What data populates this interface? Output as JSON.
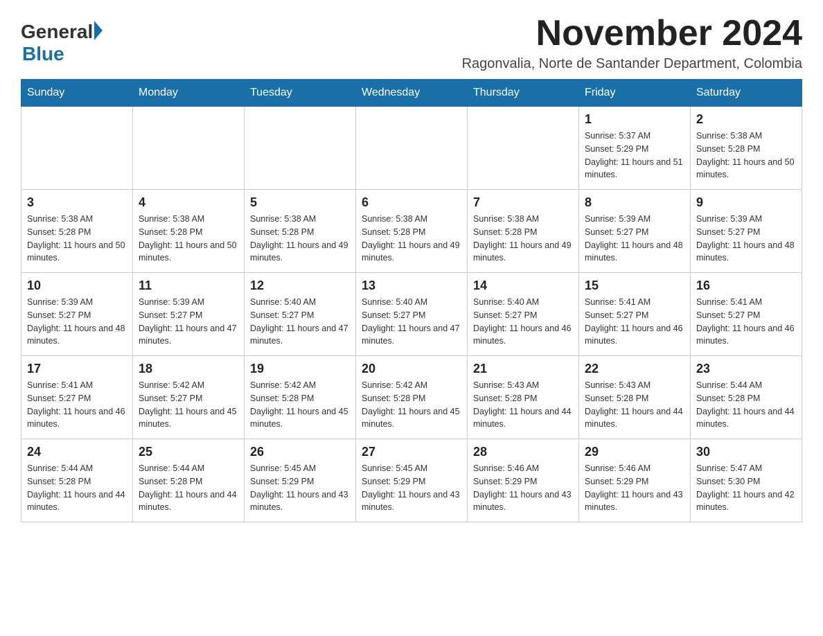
{
  "logo": {
    "general": "General",
    "blue": "Blue"
  },
  "title": "November 2024",
  "location": "Ragonvalia, Norte de Santander Department, Colombia",
  "days_of_week": [
    "Sunday",
    "Monday",
    "Tuesday",
    "Wednesday",
    "Thursday",
    "Friday",
    "Saturday"
  ],
  "weeks": [
    [
      {
        "day": "",
        "info": ""
      },
      {
        "day": "",
        "info": ""
      },
      {
        "day": "",
        "info": ""
      },
      {
        "day": "",
        "info": ""
      },
      {
        "day": "",
        "info": ""
      },
      {
        "day": "1",
        "info": "Sunrise: 5:37 AM\nSunset: 5:29 PM\nDaylight: 11 hours and 51 minutes."
      },
      {
        "day": "2",
        "info": "Sunrise: 5:38 AM\nSunset: 5:28 PM\nDaylight: 11 hours and 50 minutes."
      }
    ],
    [
      {
        "day": "3",
        "info": "Sunrise: 5:38 AM\nSunset: 5:28 PM\nDaylight: 11 hours and 50 minutes."
      },
      {
        "day": "4",
        "info": "Sunrise: 5:38 AM\nSunset: 5:28 PM\nDaylight: 11 hours and 50 minutes."
      },
      {
        "day": "5",
        "info": "Sunrise: 5:38 AM\nSunset: 5:28 PM\nDaylight: 11 hours and 49 minutes."
      },
      {
        "day": "6",
        "info": "Sunrise: 5:38 AM\nSunset: 5:28 PM\nDaylight: 11 hours and 49 minutes."
      },
      {
        "day": "7",
        "info": "Sunrise: 5:38 AM\nSunset: 5:28 PM\nDaylight: 11 hours and 49 minutes."
      },
      {
        "day": "8",
        "info": "Sunrise: 5:39 AM\nSunset: 5:27 PM\nDaylight: 11 hours and 48 minutes."
      },
      {
        "day": "9",
        "info": "Sunrise: 5:39 AM\nSunset: 5:27 PM\nDaylight: 11 hours and 48 minutes."
      }
    ],
    [
      {
        "day": "10",
        "info": "Sunrise: 5:39 AM\nSunset: 5:27 PM\nDaylight: 11 hours and 48 minutes."
      },
      {
        "day": "11",
        "info": "Sunrise: 5:39 AM\nSunset: 5:27 PM\nDaylight: 11 hours and 47 minutes."
      },
      {
        "day": "12",
        "info": "Sunrise: 5:40 AM\nSunset: 5:27 PM\nDaylight: 11 hours and 47 minutes."
      },
      {
        "day": "13",
        "info": "Sunrise: 5:40 AM\nSunset: 5:27 PM\nDaylight: 11 hours and 47 minutes."
      },
      {
        "day": "14",
        "info": "Sunrise: 5:40 AM\nSunset: 5:27 PM\nDaylight: 11 hours and 46 minutes."
      },
      {
        "day": "15",
        "info": "Sunrise: 5:41 AM\nSunset: 5:27 PM\nDaylight: 11 hours and 46 minutes."
      },
      {
        "day": "16",
        "info": "Sunrise: 5:41 AM\nSunset: 5:27 PM\nDaylight: 11 hours and 46 minutes."
      }
    ],
    [
      {
        "day": "17",
        "info": "Sunrise: 5:41 AM\nSunset: 5:27 PM\nDaylight: 11 hours and 46 minutes."
      },
      {
        "day": "18",
        "info": "Sunrise: 5:42 AM\nSunset: 5:27 PM\nDaylight: 11 hours and 45 minutes."
      },
      {
        "day": "19",
        "info": "Sunrise: 5:42 AM\nSunset: 5:28 PM\nDaylight: 11 hours and 45 minutes."
      },
      {
        "day": "20",
        "info": "Sunrise: 5:42 AM\nSunset: 5:28 PM\nDaylight: 11 hours and 45 minutes."
      },
      {
        "day": "21",
        "info": "Sunrise: 5:43 AM\nSunset: 5:28 PM\nDaylight: 11 hours and 44 minutes."
      },
      {
        "day": "22",
        "info": "Sunrise: 5:43 AM\nSunset: 5:28 PM\nDaylight: 11 hours and 44 minutes."
      },
      {
        "day": "23",
        "info": "Sunrise: 5:44 AM\nSunset: 5:28 PM\nDaylight: 11 hours and 44 minutes."
      }
    ],
    [
      {
        "day": "24",
        "info": "Sunrise: 5:44 AM\nSunset: 5:28 PM\nDaylight: 11 hours and 44 minutes."
      },
      {
        "day": "25",
        "info": "Sunrise: 5:44 AM\nSunset: 5:28 PM\nDaylight: 11 hours and 44 minutes."
      },
      {
        "day": "26",
        "info": "Sunrise: 5:45 AM\nSunset: 5:29 PM\nDaylight: 11 hours and 43 minutes."
      },
      {
        "day": "27",
        "info": "Sunrise: 5:45 AM\nSunset: 5:29 PM\nDaylight: 11 hours and 43 minutes."
      },
      {
        "day": "28",
        "info": "Sunrise: 5:46 AM\nSunset: 5:29 PM\nDaylight: 11 hours and 43 minutes."
      },
      {
        "day": "29",
        "info": "Sunrise: 5:46 AM\nSunset: 5:29 PM\nDaylight: 11 hours and 43 minutes."
      },
      {
        "day": "30",
        "info": "Sunrise: 5:47 AM\nSunset: 5:30 PM\nDaylight: 11 hours and 42 minutes."
      }
    ]
  ]
}
